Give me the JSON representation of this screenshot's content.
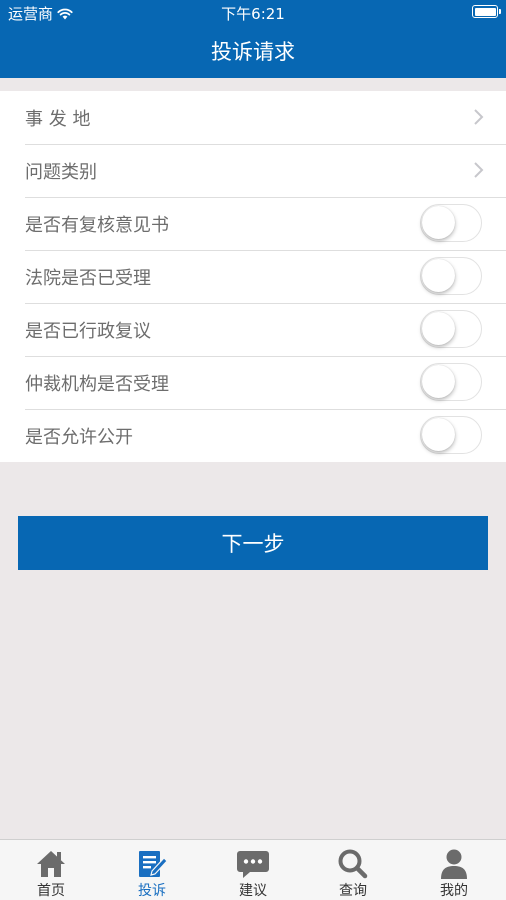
{
  "status_bar": {
    "carrier": "运营商",
    "time": "下午6:21"
  },
  "nav": {
    "title": "投诉请求"
  },
  "form": {
    "rows": [
      {
        "label": "事 发 地",
        "type": "chevron"
      },
      {
        "label": "问题类别",
        "type": "chevron"
      },
      {
        "label": "是否有复核意见书",
        "type": "toggle",
        "value": false
      },
      {
        "label": "法院是否已受理",
        "type": "toggle",
        "value": false
      },
      {
        "label": "是否已行政复议",
        "type": "toggle",
        "value": false
      },
      {
        "label": "仲裁机构是否受理",
        "type": "toggle",
        "value": false
      },
      {
        "label": "是否允许公开",
        "type": "toggle",
        "value": false
      }
    ]
  },
  "next_button": {
    "label": "下一步"
  },
  "tab_bar": {
    "items": [
      {
        "label": "首页",
        "icon": "home-icon"
      },
      {
        "label": "投诉",
        "icon": "edit-document-icon",
        "active": true
      },
      {
        "label": "建议",
        "icon": "chat-bubble-icon"
      },
      {
        "label": "查询",
        "icon": "search-icon"
      },
      {
        "label": "我的",
        "icon": "user-icon"
      }
    ]
  },
  "colors": {
    "primary": "#0767b3",
    "background": "#ece8e9",
    "tab_active": "#1a6fc1",
    "tab_inactive": "#6b6b6b"
  }
}
